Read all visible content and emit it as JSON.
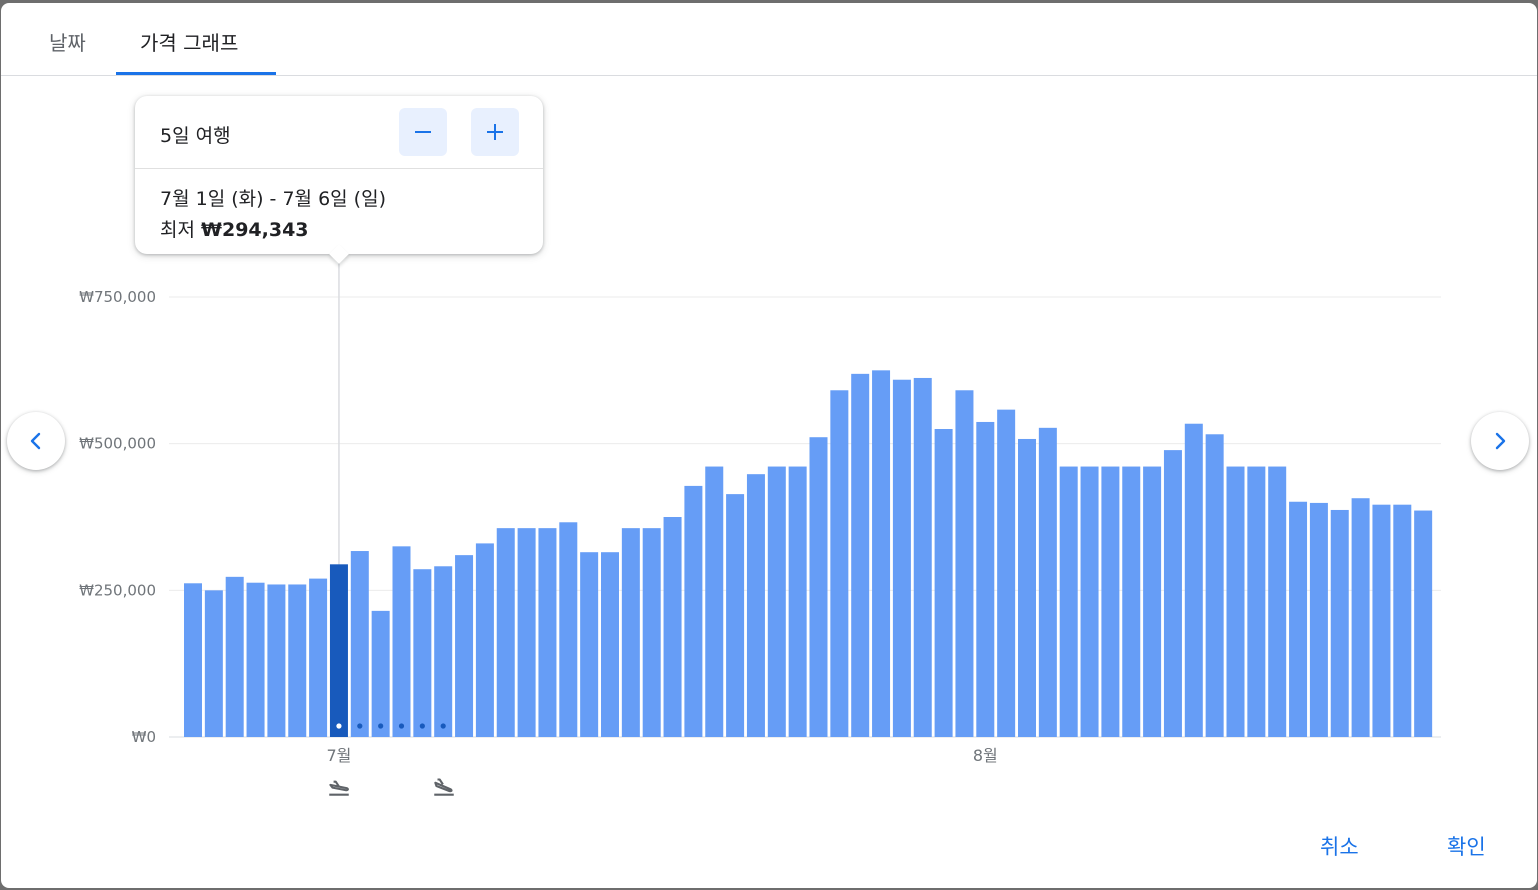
{
  "tabs": [
    {
      "label": "날짜",
      "selected": false
    },
    {
      "label": "가격 그래프",
      "selected": true
    }
  ],
  "tooltip": {
    "trip_length": "5일 여행",
    "dates": "7월 1일 (화) - 7월 6일 (일)",
    "price_prefix": "최저",
    "price": "₩294,343"
  },
  "buttons": {
    "cancel": "취소",
    "ok": "확인"
  },
  "icons": {
    "decrease": "minus-icon",
    "increase": "plus-icon",
    "prev": "chevron-left-icon",
    "next": "chevron-right-icon",
    "departure": "flight-takeoff-icon",
    "return": "flight-land-icon"
  },
  "colors": {
    "bar": "#669df6",
    "bar_selected": "#185abc",
    "accent": "#1a73e8"
  },
  "chart_data": {
    "type": "bar",
    "ylim": [
      0,
      750000
    ],
    "y_ticks": [
      "₩0",
      "₩250,000",
      "₩500,000",
      "₩750,000"
    ],
    "y_tick_values": [
      0,
      250000,
      500000,
      750000
    ],
    "month_labels": [
      {
        "label": "7월",
        "index": 7
      },
      {
        "label": "8월",
        "index": 38
      }
    ],
    "selected_index": 7,
    "trip_span_days": 5,
    "values": [
      262000,
      250000,
      273000,
      263000,
      260000,
      260000,
      270000,
      294343,
      317000,
      215000,
      325000,
      286000,
      291000,
      310000,
      330000,
      356000,
      356000,
      356000,
      366000,
      315000,
      315000,
      356000,
      356000,
      375000,
      428000,
      461000,
      414000,
      448000,
      461000,
      461000,
      511000,
      591000,
      619000,
      625000,
      609000,
      612000,
      525000,
      591000,
      537000,
      558000,
      508000,
      527000,
      461000,
      461000,
      461000,
      461000,
      461000,
      489000,
      534000,
      516000,
      461000,
      461000,
      461000,
      401000,
      399000,
      387000,
      407000,
      396000,
      396000,
      386000
    ]
  }
}
